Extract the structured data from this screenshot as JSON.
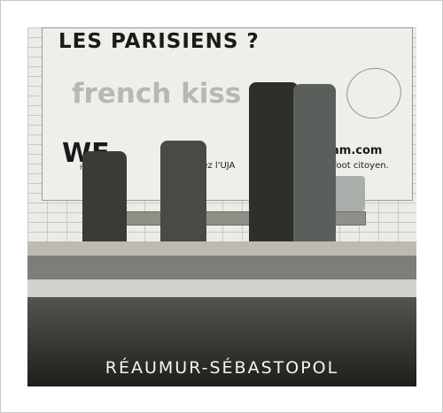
{
  "poster": {
    "title": "LES PARISIENS ?",
    "subtitle": "french kiss",
    "logo": "WE",
    "logo_small": "have",
    "middle_text": "nez l'UJA",
    "url": "am.com",
    "slogan": "foot citoyen."
  },
  "caption": {
    "station_name": "RÉAUMUR-SÉBASTOPOL"
  }
}
